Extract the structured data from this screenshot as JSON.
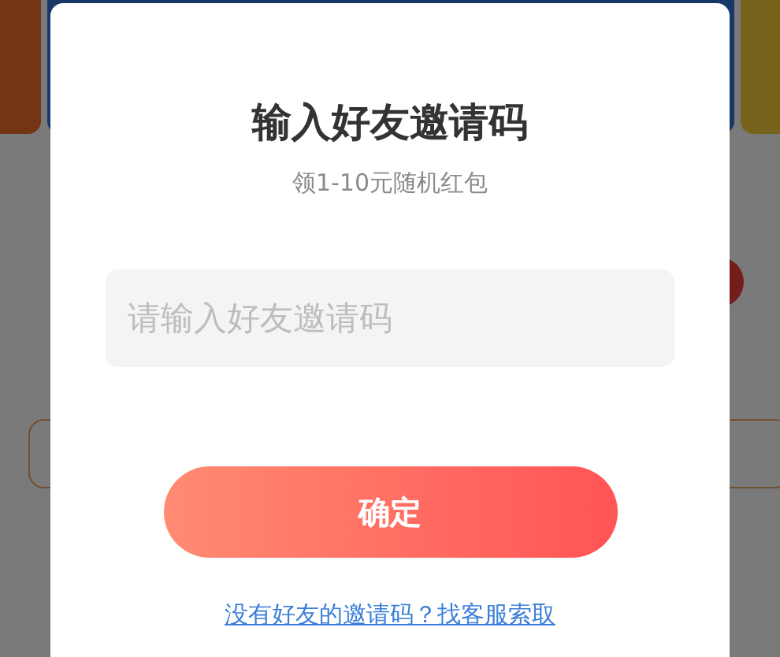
{
  "dialog": {
    "title": "输入好友邀请码",
    "subtitle": "领1-10元随机红包",
    "invite_code_field": {
      "placeholder": "请输入好友邀请码"
    },
    "confirm_button": "确定",
    "help_link": "没有好友的邀请码？找客服索取"
  }
}
